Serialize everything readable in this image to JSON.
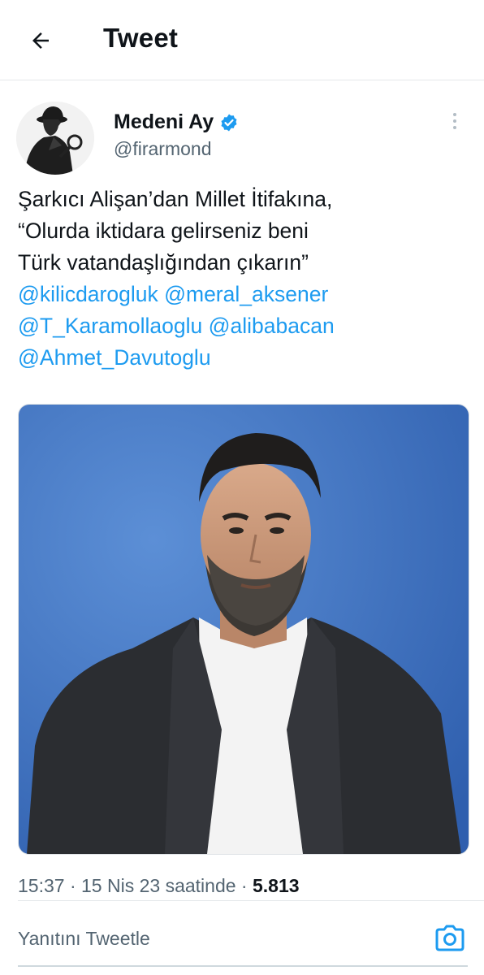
{
  "header": {
    "title": "Tweet",
    "back_icon": "arrow-left-icon"
  },
  "author": {
    "display_name": "Medeni Ay",
    "handle": "@firarmond",
    "verified": true,
    "verified_color": "#1d9bf0"
  },
  "tweet": {
    "text_lines": [
      "Şarkıcı Alişan’dan Millet İtifakına,",
      "“Olurda iktidara gelirseniz beni",
      "Türk vatandaşlığından çıkarın”"
    ],
    "mentions": [
      "@kilicdarogluk",
      "@meral_aksener",
      "@T_Karamollaoglu",
      "@alibabacan",
      "@Ahmet_Davutoglu"
    ],
    "mention_color": "#1d9bf0"
  },
  "meta": {
    "time": "15:37",
    "separator": " · ",
    "date": "15 Nis 23 saatinde",
    "views": "5.813"
  },
  "reply": {
    "placeholder": "Yanıtını Tweetle",
    "camera_icon": "camera-icon",
    "accent": "#1d9bf0"
  }
}
